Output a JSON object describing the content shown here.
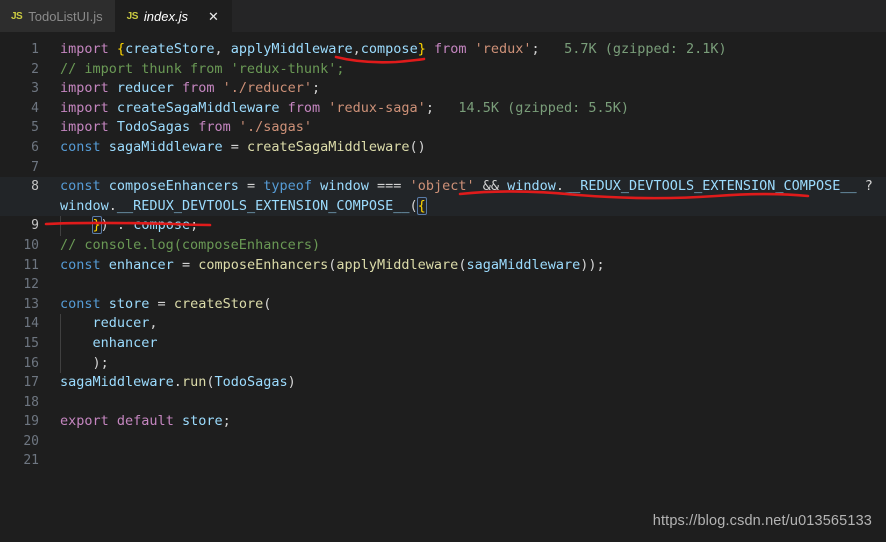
{
  "window": {
    "app": "vscode-editor",
    "background": "#1e1e1e"
  },
  "tabbar": {
    "tabs": [
      {
        "label": "TodoListUI.js",
        "icon": "JS",
        "active": false,
        "closable": false
      },
      {
        "label": "index.js",
        "icon": "JS",
        "active": true,
        "closable": true,
        "close_glyph": "✕"
      }
    ]
  },
  "editor": {
    "language": "javascript",
    "file": "index.js",
    "current_line": 8,
    "total_visible_lines": 21,
    "lines": [
      {
        "n": "1",
        "text": "import {createStore, applyMiddleware,compose} from 'redux';   5.7K (gzipped: 2.1K)"
      },
      {
        "n": "2",
        "text": "// import thunk from 'redux-thunk';"
      },
      {
        "n": "3",
        "text": "import reducer from './reducer';"
      },
      {
        "n": "4",
        "text": "import createSagaMiddleware from 'redux-saga';   14.5K (gzipped: 5.5K)"
      },
      {
        "n": "5",
        "text": "import TodoSagas from './sagas'"
      },
      {
        "n": "6",
        "text": "const sagaMiddleware = createSagaMiddleware()"
      },
      {
        "n": "7",
        "text": ""
      },
      {
        "n": "8",
        "text": "const composeEnhancers = typeof window === 'object' && window.__REDUX_DEVTOOLS_EXTENSION_COMPOSE__ ?"
      },
      {
        "n": "",
        "text": "window.__REDUX_DEVTOOLS_EXTENSION_COMPOSE__({"
      },
      {
        "n": "9",
        "text": "    }) : compose;"
      },
      {
        "n": "10",
        "text": "// console.log(composeEnhancers)"
      },
      {
        "n": "11",
        "text": "const enhancer = composeEnhancers(applyMiddleware(sagaMiddleware));"
      },
      {
        "n": "12",
        "text": ""
      },
      {
        "n": "13",
        "text": "const store = createStore("
      },
      {
        "n": "14",
        "text": "    reducer,"
      },
      {
        "n": "15",
        "text": "    enhancer"
      },
      {
        "n": "16",
        "text": "    );"
      },
      {
        "n": "17",
        "text": "sagaMiddleware.run(TodoSagas)"
      },
      {
        "n": "18",
        "text": ""
      },
      {
        "n": "19",
        "text": "export default store;"
      },
      {
        "n": "20",
        "text": ""
      },
      {
        "n": "21",
        "text": ""
      }
    ],
    "import_costs": [
      {
        "line": "1",
        "text": "5.7K (gzipped: 2.1K)"
      },
      {
        "line": "4",
        "text": "14.5K (gzipped: 5.5K)"
      }
    ],
    "tokens": {
      "l1": {
        "import": "import",
        "brace_open": "{",
        "createStore": "createStore",
        "comma1": ", ",
        "applyMiddleware": "applyMiddleware",
        "comma2": ",",
        "compose": "compose",
        "brace_close": "}",
        "from": "from",
        "module": "'redux'",
        "semi": ";",
        "cost": "5.7K (gzipped: 2.1K)"
      },
      "l2": {
        "comment": "// import thunk from 'redux-thunk';"
      },
      "l3": {
        "import": "import",
        "name": "reducer",
        "from": "from",
        "module": "'./reducer'",
        "semi": ";"
      },
      "l4": {
        "import": "import",
        "name": "createSagaMiddleware",
        "from": "from",
        "module": "'redux-saga'",
        "semi": ";",
        "cost": "14.5K (gzipped: 5.5K)"
      },
      "l5": {
        "import": "import",
        "name": "TodoSagas",
        "from": "from",
        "module": "'./sagas'"
      },
      "l6": {
        "const": "const",
        "name": "sagaMiddleware",
        "eq": " = ",
        "call": "createSagaMiddleware",
        "parens": "()"
      },
      "l8a": {
        "const": "const",
        "name": "composeEnhancers",
        "eq": " = ",
        "typeof": "typeof",
        "window": "window",
        "eqeqeq": " === ",
        "object": "'object'",
        "and": " && ",
        "window2": "window",
        "dot": ".",
        "prop": "__REDUX_DEVTOOLS_EXTENSION_COMPOSE__",
        "q": " ?"
      },
      "l8b": {
        "window": "window",
        "dot": ".",
        "prop": "__REDUX_DEVTOOLS_EXTENSION_COMPOSE__",
        "paren": "(",
        "brace": "{"
      },
      "l9": {
        "brace": "}",
        "paren": ")",
        "colon": " : ",
        "compose": "compose",
        "semi": ";"
      },
      "l10": {
        "comment": "// console.log(composeEnhancers)"
      },
      "l11": {
        "const": "const",
        "name": "enhancer",
        "eq": " = ",
        "call1": "composeEnhancers",
        "p1": "(",
        "call2": "applyMiddleware",
        "p2": "(",
        "arg": "sagaMiddleware",
        "close": "));"
      },
      "l13": {
        "const": "const",
        "name": "store",
        "eq": " = ",
        "call": "createStore",
        "paren": "("
      },
      "l14": {
        "name": "reducer",
        "comma": ","
      },
      "l15": {
        "name": "enhancer"
      },
      "l16": {
        "close": ");"
      },
      "l17": {
        "obj": "sagaMiddleware",
        "dot": ".",
        "method": "run",
        "p1": "(",
        "arg": "TodoSagas",
        "p2": ")"
      },
      "l19": {
        "export": "export",
        "default": "default",
        "name": "store",
        "semi": ";"
      }
    }
  },
  "annotations": {
    "color": "#e01b1b",
    "marks": [
      {
        "id": "underline-compose-line1",
        "target": "compose (line 1)"
      },
      {
        "id": "underline-devtools-line8",
        "target": "window.__REDUX_DEVTOOLS_EXTENSION_COMPOSE__ (line 8)"
      },
      {
        "id": "underline-close-line9",
        "target": "}) : compose; (line 9)"
      }
    ]
  },
  "watermark": {
    "text": "https://blog.csdn.net/u013565133"
  },
  "colors": {
    "editor_bg": "#1e1e1e",
    "tabbar_bg": "#252526",
    "tab_inactive_bg": "#2d2d2d",
    "keyword": "#569cd6",
    "import_keyword": "#c586c0",
    "identifier": "#9cdcfe",
    "function": "#dcdcaa",
    "string": "#ce9178",
    "comment": "#6a9955",
    "import_cost": "#7a9e7a",
    "annotation_red": "#e01b1b"
  }
}
